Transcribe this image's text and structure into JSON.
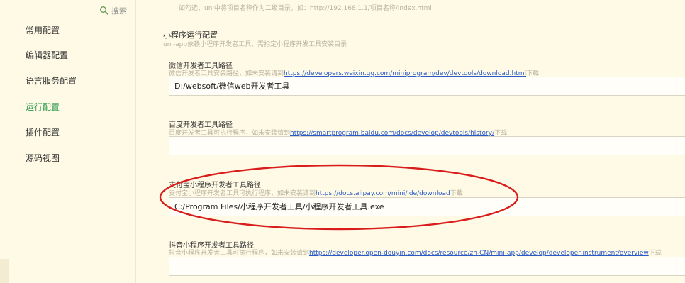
{
  "sidebar": {
    "search_label": "搜索",
    "items": [
      {
        "label": "常用配置"
      },
      {
        "label": "编辑器配置"
      },
      {
        "label": "语言服务配置"
      },
      {
        "label": "运行配置"
      },
      {
        "label": "插件配置"
      },
      {
        "label": "源码视图"
      }
    ],
    "active_item": "运行配置",
    "active_color": "#2e9a4c"
  },
  "top_hint": "如勾选，uni中将项目名称作为二级目录，如：http://192.168.1.1/项目名称/index.html",
  "section": {
    "title": "小程序运行配置",
    "subtitle": "uni-app依赖小程序开发者工具，需指定小程序开发工具安装目录"
  },
  "fields": [
    {
      "label": "微信开发者工具路径",
      "desc_prefix": "微信开发者工具安装路径，如未安装请到",
      "link": "https://developers.weixin.qq.com/miniprogram/dev/devtools/download.html",
      "desc_suffix": "下载",
      "value": "D:/websoft/微信web开发者工具"
    },
    {
      "label": "百度开发者工具路径",
      "desc_prefix": "百度开发者工具可执行程序，如未安装请到",
      "link": "https://smartprogram.baidu.com/docs/develop/devtools/history/",
      "desc_suffix": "下载",
      "value": ""
    },
    {
      "label": "支付宝小程序开发者工具路径",
      "desc_prefix": "支付宝小程序开发者工具可执行程序，如未安装请到",
      "link": "https://docs.alipay.com/mini/ide/download",
      "desc_suffix": "下载",
      "value": "C:/Program Files/小程序开发者工具/小程序开发者工具.exe"
    },
    {
      "label": "抖音小程序开发者工具路径",
      "desc_prefix": "抖音小程序开发者工具可执行程序，如未安装请到",
      "link": "https://developer.open-douyin.com/docs/resource/zh-CN/mini-app/develop/developer-instrument/overview",
      "desc_suffix": "下载",
      "value": ""
    }
  ],
  "highlight_color": "#d91c1c",
  "link_color": "#2a5bc9"
}
